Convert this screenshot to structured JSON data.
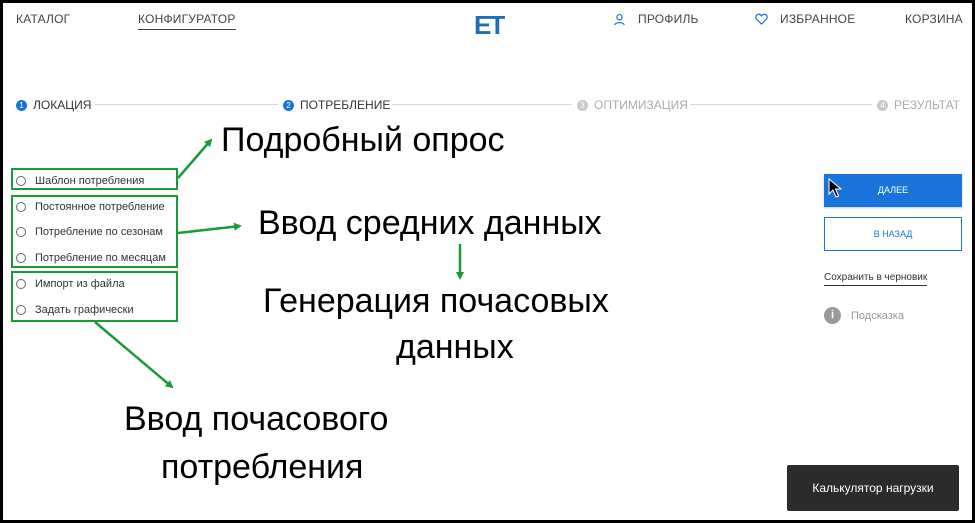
{
  "nav": {
    "catalog": "КАТАЛОГ",
    "configurator": "КОНФИГУРАТОР",
    "logo": "ET",
    "profile": "ПРОФИЛЬ",
    "favorites": "ИЗБРАННОЕ",
    "cart": "КОРЗИНА"
  },
  "steps": [
    {
      "num": "1",
      "label": "ЛОКАЦИЯ",
      "state": "active"
    },
    {
      "num": "2",
      "label": "ПОТРЕБЛЕНИЕ",
      "state": "active"
    },
    {
      "num": "3",
      "label": "ОПТИМИЗАЦИЯ",
      "state": "inactive"
    },
    {
      "num": "4",
      "label": "РЕЗУЛЬТАТ",
      "state": "inactive"
    }
  ],
  "options": {
    "template": "Шаблон потребления",
    "constant": "Постоянное потребление",
    "seasons": "Потребление по сезонам",
    "months": "Потребление по месяцам",
    "import": "Импорт из файла",
    "graphic": "Задать графически"
  },
  "annotations": {
    "detailed": "Подробный опрос",
    "average": "Ввод средних данных",
    "generation_line1": "Генерация почасовых",
    "generation_line2": "данных",
    "hourly_line1": "Ввод почасового",
    "hourly_line2": "потребления"
  },
  "actions": {
    "next": "ДАЛЕЕ",
    "back": "В НАЗАД",
    "save_draft": "Сохранить в черновик",
    "hint": "Подсказка",
    "hint_icon_glyph": "i",
    "calculator": "Калькулятор нагрузки"
  },
  "colors": {
    "accent": "#1a73d9",
    "annotation_green": "#1a9b3a",
    "step_inactive": "#c8c8c8"
  }
}
